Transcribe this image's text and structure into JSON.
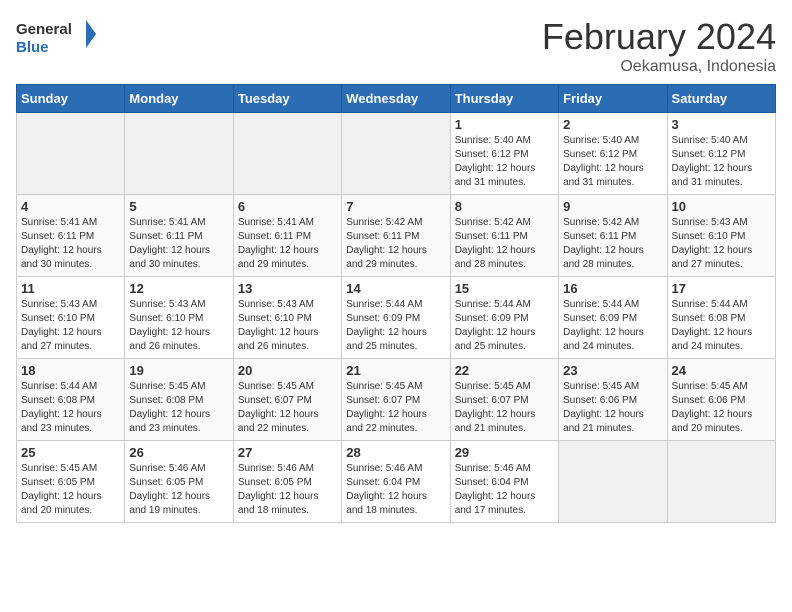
{
  "logo": {
    "text_general": "General",
    "text_blue": "Blue"
  },
  "title": "February 2024",
  "subtitle": "Oekamusa, Indonesia",
  "days_of_week": [
    "Sunday",
    "Monday",
    "Tuesday",
    "Wednesday",
    "Thursday",
    "Friday",
    "Saturday"
  ],
  "weeks": [
    [
      {
        "day": "",
        "info": ""
      },
      {
        "day": "",
        "info": ""
      },
      {
        "day": "",
        "info": ""
      },
      {
        "day": "",
        "info": ""
      },
      {
        "day": "1",
        "info": "Sunrise: 5:40 AM\nSunset: 6:12 PM\nDaylight: 12 hours and 31 minutes."
      },
      {
        "day": "2",
        "info": "Sunrise: 5:40 AM\nSunset: 6:12 PM\nDaylight: 12 hours and 31 minutes."
      },
      {
        "day": "3",
        "info": "Sunrise: 5:40 AM\nSunset: 6:12 PM\nDaylight: 12 hours and 31 minutes."
      }
    ],
    [
      {
        "day": "4",
        "info": "Sunrise: 5:41 AM\nSunset: 6:11 PM\nDaylight: 12 hours and 30 minutes."
      },
      {
        "day": "5",
        "info": "Sunrise: 5:41 AM\nSunset: 6:11 PM\nDaylight: 12 hours and 30 minutes."
      },
      {
        "day": "6",
        "info": "Sunrise: 5:41 AM\nSunset: 6:11 PM\nDaylight: 12 hours and 29 minutes."
      },
      {
        "day": "7",
        "info": "Sunrise: 5:42 AM\nSunset: 6:11 PM\nDaylight: 12 hours and 29 minutes."
      },
      {
        "day": "8",
        "info": "Sunrise: 5:42 AM\nSunset: 6:11 PM\nDaylight: 12 hours and 28 minutes."
      },
      {
        "day": "9",
        "info": "Sunrise: 5:42 AM\nSunset: 6:11 PM\nDaylight: 12 hours and 28 minutes."
      },
      {
        "day": "10",
        "info": "Sunrise: 5:43 AM\nSunset: 6:10 PM\nDaylight: 12 hours and 27 minutes."
      }
    ],
    [
      {
        "day": "11",
        "info": "Sunrise: 5:43 AM\nSunset: 6:10 PM\nDaylight: 12 hours and 27 minutes."
      },
      {
        "day": "12",
        "info": "Sunrise: 5:43 AM\nSunset: 6:10 PM\nDaylight: 12 hours and 26 minutes."
      },
      {
        "day": "13",
        "info": "Sunrise: 5:43 AM\nSunset: 6:10 PM\nDaylight: 12 hours and 26 minutes."
      },
      {
        "day": "14",
        "info": "Sunrise: 5:44 AM\nSunset: 6:09 PM\nDaylight: 12 hours and 25 minutes."
      },
      {
        "day": "15",
        "info": "Sunrise: 5:44 AM\nSunset: 6:09 PM\nDaylight: 12 hours and 25 minutes."
      },
      {
        "day": "16",
        "info": "Sunrise: 5:44 AM\nSunset: 6:09 PM\nDaylight: 12 hours and 24 minutes."
      },
      {
        "day": "17",
        "info": "Sunrise: 5:44 AM\nSunset: 6:08 PM\nDaylight: 12 hours and 24 minutes."
      }
    ],
    [
      {
        "day": "18",
        "info": "Sunrise: 5:44 AM\nSunset: 6:08 PM\nDaylight: 12 hours and 23 minutes."
      },
      {
        "day": "19",
        "info": "Sunrise: 5:45 AM\nSunset: 6:08 PM\nDaylight: 12 hours and 23 minutes."
      },
      {
        "day": "20",
        "info": "Sunrise: 5:45 AM\nSunset: 6:07 PM\nDaylight: 12 hours and 22 minutes."
      },
      {
        "day": "21",
        "info": "Sunrise: 5:45 AM\nSunset: 6:07 PM\nDaylight: 12 hours and 22 minutes."
      },
      {
        "day": "22",
        "info": "Sunrise: 5:45 AM\nSunset: 6:07 PM\nDaylight: 12 hours and 21 minutes."
      },
      {
        "day": "23",
        "info": "Sunrise: 5:45 AM\nSunset: 6:06 PM\nDaylight: 12 hours and 21 minutes."
      },
      {
        "day": "24",
        "info": "Sunrise: 5:45 AM\nSunset: 6:06 PM\nDaylight: 12 hours and 20 minutes."
      }
    ],
    [
      {
        "day": "25",
        "info": "Sunrise: 5:45 AM\nSunset: 6:05 PM\nDaylight: 12 hours and 20 minutes."
      },
      {
        "day": "26",
        "info": "Sunrise: 5:46 AM\nSunset: 6:05 PM\nDaylight: 12 hours and 19 minutes."
      },
      {
        "day": "27",
        "info": "Sunrise: 5:46 AM\nSunset: 6:05 PM\nDaylight: 12 hours and 18 minutes."
      },
      {
        "day": "28",
        "info": "Sunrise: 5:46 AM\nSunset: 6:04 PM\nDaylight: 12 hours and 18 minutes."
      },
      {
        "day": "29",
        "info": "Sunrise: 5:46 AM\nSunset: 6:04 PM\nDaylight: 12 hours and 17 minutes."
      },
      {
        "day": "",
        "info": ""
      },
      {
        "day": "",
        "info": ""
      }
    ]
  ]
}
